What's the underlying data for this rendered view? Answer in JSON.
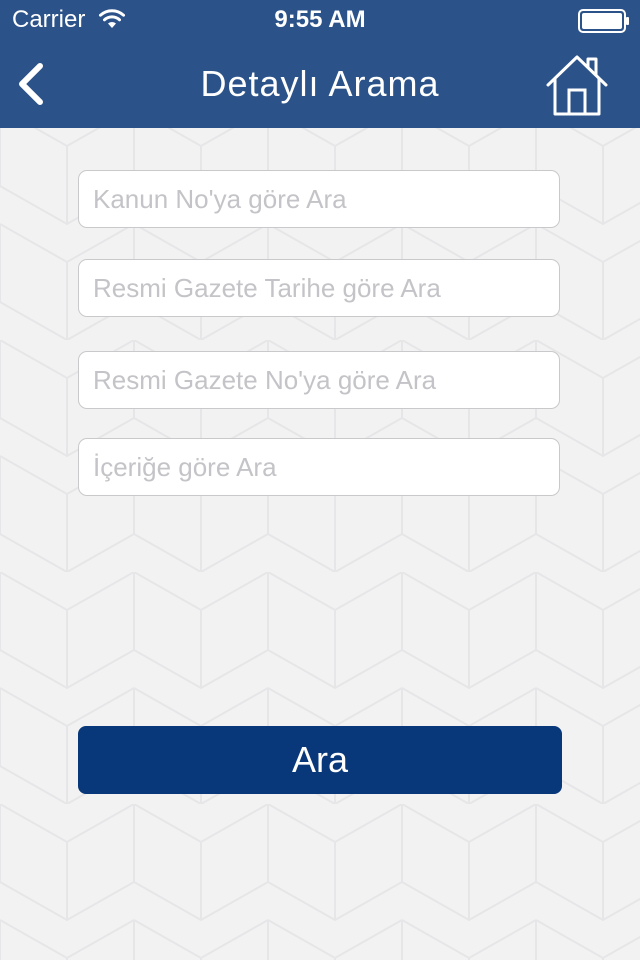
{
  "status_bar": {
    "carrier": "Carrier",
    "time": "9:55 AM",
    "wifi_icon": "wifi-icon",
    "battery_icon": "battery-icon"
  },
  "nav": {
    "title": "Detaylı Arama",
    "back_icon": "chevron-left-icon",
    "home_icon": "home-icon"
  },
  "form": {
    "fields": [
      {
        "placeholder": "Kanun No'ya göre Ara",
        "value": ""
      },
      {
        "placeholder": "Resmi Gazete Tarihe göre Ara",
        "value": ""
      },
      {
        "placeholder": "Resmi Gazete No'ya göre Ara",
        "value": ""
      },
      {
        "placeholder": "İçeriğe göre Ara",
        "value": ""
      }
    ],
    "submit_label": "Ara"
  },
  "colors": {
    "nav_background": "#2b5289",
    "button_background": "#08387a",
    "page_background": "#f2f2f2",
    "pattern_line": "#e6e6e8",
    "field_border": "#c9c9cc",
    "placeholder_text": "#c4c4c8"
  }
}
